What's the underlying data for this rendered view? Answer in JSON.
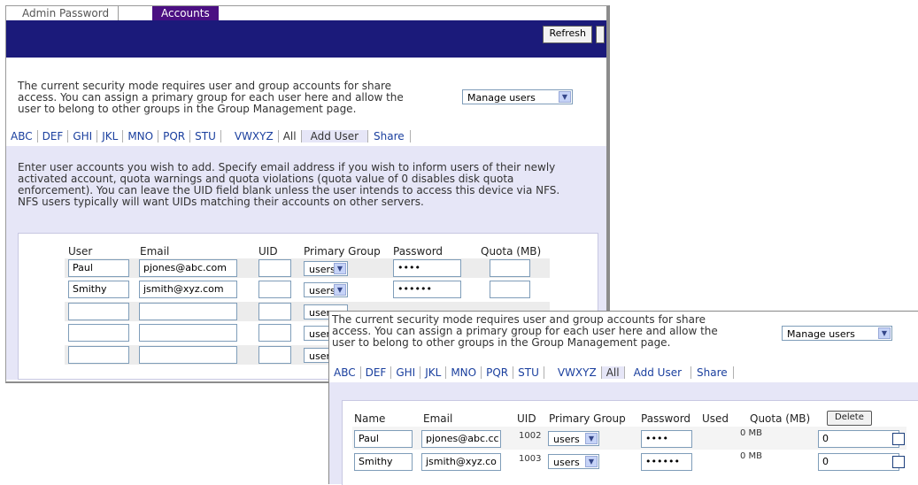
{
  "back": {
    "tabs": [
      {
        "label": "Admin Password"
      },
      {
        "label": "Accounts"
      }
    ],
    "refresh_label": "Refresh",
    "intro": [
      "The current security mode requires user and group accounts for share",
      "access. You can assign a primary group for each user here and allow the",
      "user to belong to other groups in the Group Management page."
    ],
    "manage_select": "Manage users",
    "alpha": [
      "ABC",
      "DEF",
      "GHI",
      "JKL",
      "MNO",
      "PQR",
      "STU",
      "VWXYZ",
      "All",
      "Add User",
      "Share"
    ],
    "instructions": [
      "Enter user accounts you wish to add. Specify email address if you wish to inform users of their newly",
      "activated account, quota warnings and quota violations (quota value of 0 disables disk quota",
      "enforcement). You can leave the UID field blank unless the user intends to access this device via NFS.",
      "NFS users typically will want UIDs matching their accounts on other servers."
    ],
    "columns": [
      "User",
      "Email",
      "UID",
      "Primary Group",
      "Password",
      "Quota (MB)"
    ],
    "rows": [
      {
        "user": "Paul",
        "email": "pjones@abc.com",
        "uid": "",
        "group": "users",
        "password": "••••",
        "quota": ""
      },
      {
        "user": "Smithy",
        "email": "jsmith@xyz.com",
        "uid": "",
        "group": "users",
        "password": "••••••",
        "quota": ""
      },
      {
        "user": "",
        "email": "",
        "uid": "",
        "group": "users",
        "password": "",
        "quota": ""
      },
      {
        "user": "",
        "email": "",
        "uid": "",
        "group": "user",
        "password": "",
        "quota": ""
      },
      {
        "user": "",
        "email": "",
        "uid": "",
        "group": "user",
        "password": "",
        "quota": ""
      }
    ]
  },
  "front": {
    "intro": [
      "The current security mode requires user and group accounts for share",
      "access. You can assign a primary group for each user here and allow the",
      "user to belong to other groups in the Group Management page."
    ],
    "manage_select": "Manage users",
    "alpha": [
      "ABC",
      "DEF",
      "GHI",
      "JKL",
      "MNO",
      "PQR",
      "STU",
      "VWXYZ",
      "All",
      "Add User",
      "Share"
    ],
    "columns": [
      "Name",
      "Email",
      "UID",
      "Primary Group",
      "Password",
      "Used",
      "Quota (MB)"
    ],
    "delete_label": "Delete",
    "rows": [
      {
        "name": "Paul",
        "email": "pjones@abc.cc",
        "uid": "1002",
        "group": "users",
        "password": "••••",
        "used": "0 MB",
        "quota": "0"
      },
      {
        "name": "Smithy",
        "email": "jsmith@xyz.co",
        "uid": "1003",
        "group": "users",
        "password": "••••••",
        "used": "0 MB",
        "quota": "0"
      }
    ]
  }
}
